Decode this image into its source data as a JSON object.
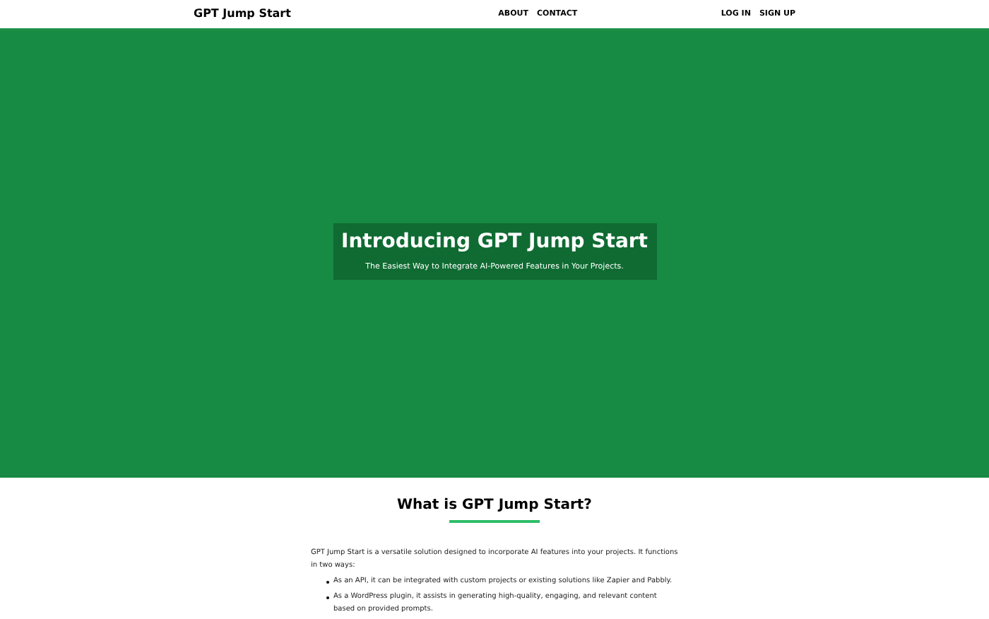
{
  "nav": {
    "brand": "GPT Jump Start",
    "center_links": [
      "ABOUT",
      "CONTACT"
    ],
    "right_links": [
      "LOG IN",
      "SIGN UP"
    ]
  },
  "hero": {
    "title": "Introducing GPT Jump Start",
    "subtitle": "The Easiest Way to Integrate AI-Powered Features in Your Projects."
  },
  "about": {
    "heading": "What is GPT Jump Start?",
    "intro": "GPT Jump Start is a versatile solution designed to incorporate AI features into your projects. It functions in two ways:",
    "bullets": [
      "As an API, it can be integrated with custom projects or existing solutions like Zapier and Pabbly.",
      "As a WordPress plugin, it assists in generating high-quality, engaging, and relevant content based on provided prompts."
    ]
  }
}
